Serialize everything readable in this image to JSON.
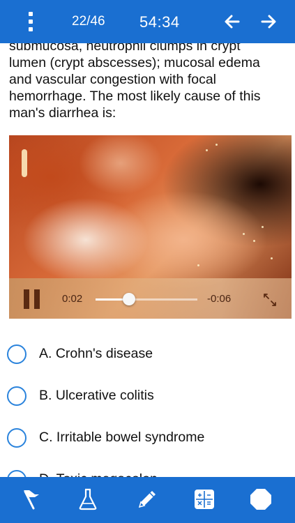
{
  "header": {
    "counter": "22/46",
    "timer": "54:34",
    "menu_icon": "vertical-dots-icon",
    "prev_icon": "arrow-left-icon",
    "next_icon": "arrow-right-icon"
  },
  "question": {
    "text_line1": "submucosa, neutrophil clumps in crypt",
    "text_line2": "lumen (crypt abscesses); mucosal edema",
    "text_line3": "and vascular congestion with focal",
    "text_line4": "hemorrhage. The most likely cause of this",
    "text_line5": "man's diarrhea is:"
  },
  "video": {
    "current_time": "0:02",
    "remaining_time": "-0:06",
    "progress": 0.33,
    "pause_icon": "pause-icon",
    "fullscreen_icon": "expand-icon"
  },
  "options": [
    {
      "label": "A. Crohn's disease"
    },
    {
      "label": "B. Ulcerative colitis"
    },
    {
      "label": "C. Irritable bowel syndrome"
    },
    {
      "label": "D. Toxic megacolon"
    }
  ],
  "toolbar": {
    "items": [
      "flag-icon",
      "lab-flask-icon",
      "pencil-icon",
      "calculator-icon",
      "stop-icon"
    ]
  },
  "colors": {
    "primary": "#1a6fd1",
    "radio": "#2a83dc"
  }
}
